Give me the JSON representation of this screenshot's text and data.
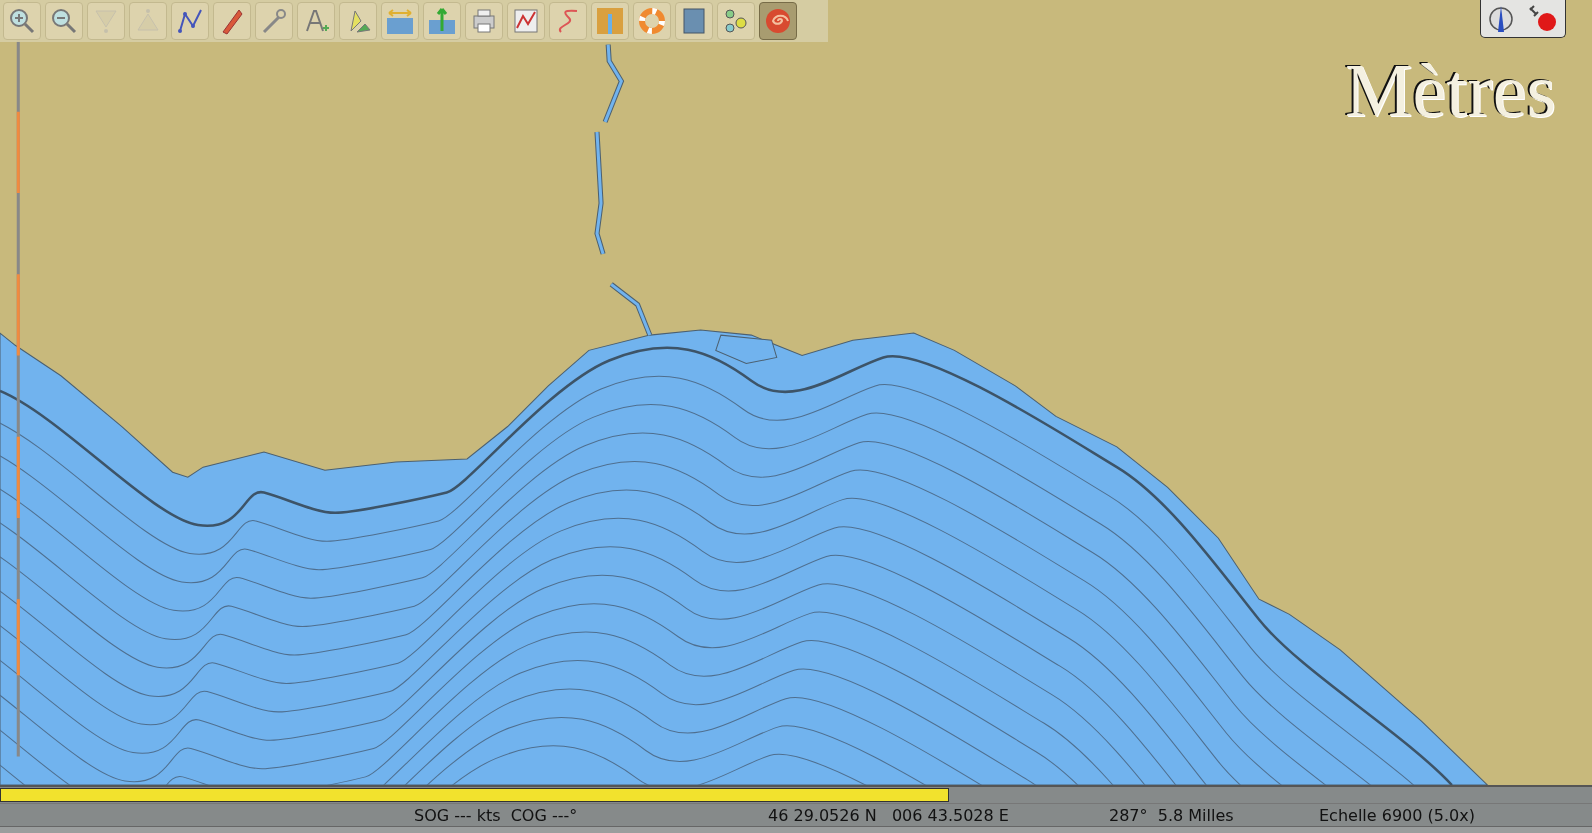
{
  "toolbar": {
    "buttons": [
      {
        "disabled": false,
        "selected": false
      },
      {
        "disabled": false,
        "selected": false
      },
      {
        "disabled": true,
        "selected": false
      },
      {
        "disabled": true,
        "selected": false
      },
      {
        "disabled": false,
        "selected": false
      },
      {
        "disabled": false,
        "selected": false
      },
      {
        "disabled": false,
        "selected": false
      },
      {
        "disabled": false,
        "selected": false
      },
      {
        "disabled": false,
        "selected": false
      },
      {
        "disabled": false,
        "selected": false
      },
      {
        "disabled": false,
        "selected": false
      },
      {
        "disabled": false,
        "selected": false
      },
      {
        "disabled": false,
        "selected": false
      },
      {
        "disabled": false,
        "selected": false
      },
      {
        "disabled": false,
        "selected": false
      },
      {
        "disabled": false,
        "selected": false
      },
      {
        "disabled": false,
        "selected": false
      },
      {
        "disabled": false,
        "selected": false
      },
      {
        "disabled": false,
        "selected": true
      }
    ]
  },
  "chart": {
    "units_label": "Mètres"
  },
  "progress": {
    "level": 0.596
  },
  "status_bar": {
    "fields": [
      "SOG --- kts  COG ---°",
      "46 29.0526 N   006 43.5028 E",
      "287°  5.8 Milles",
      "Echelle 6900 (5.0x)"
    ]
  }
}
